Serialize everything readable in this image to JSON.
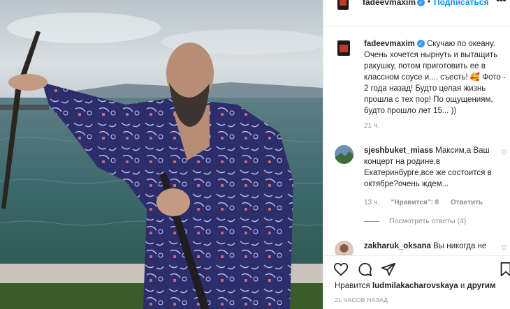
{
  "header": {
    "username": "fadeevmaxim",
    "dot": "•",
    "follow_label": "Подписаться",
    "more": "•••"
  },
  "post": {
    "username": "fadeevmaxim",
    "caption": "Скучаю по океану. Очень хочется нырнуть и вытащить ракушку, потом приготовить ее в классном соусе и.... съесть! 🥰 Фото - 2 года назад! Будто целая жизнь прошла с тех пор! По ощущениям, будто прошло лет 15... ))",
    "time": "21 ч."
  },
  "comments": [
    {
      "username": "sjeshbuket_miass",
      "text": "Максим,а Ваш концерт на родине,в Екатеринбурге,все же состоится в октябре?очень ждем...",
      "time": "13 ч.",
      "likes": "\"Нравится\": 8",
      "reply": "Ответить",
      "view_replies": "Посмотреть ответы (4)"
    },
    {
      "username": "zakharuk_oksana",
      "text": "Вы никогда не"
    }
  ],
  "likes_bar": {
    "prefix": "Нравится",
    "user": "ludmilakacharovskaya",
    "middle": "и",
    "suffix": "другим"
  },
  "timestamp": "21 ЧАСОВ НАЗАД",
  "colors": {
    "accent": "#0095f6",
    "verify": "#3897f0",
    "muted": "#8e8e8e",
    "robe": "#2e2f6e"
  },
  "icons": [
    "heart-icon",
    "comment-icon",
    "share-icon",
    "bookmark-icon",
    "more-icon",
    "verified-icon"
  ]
}
